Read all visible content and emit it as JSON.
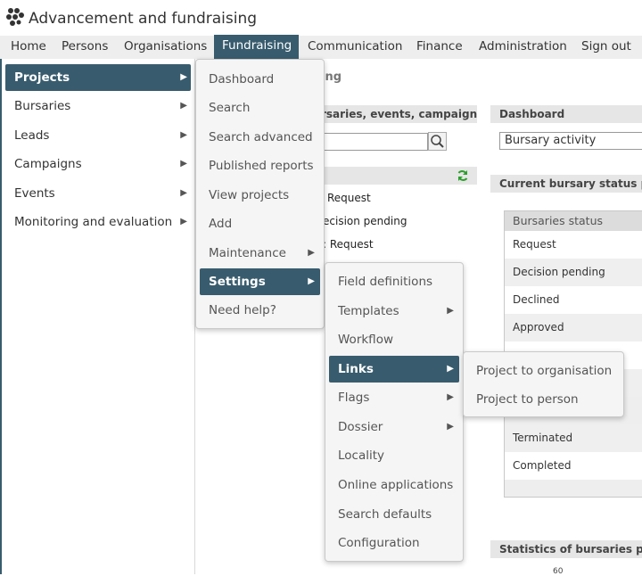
{
  "app": {
    "title": "Advancement and fundraising"
  },
  "menubar": [
    {
      "label": "Home"
    },
    {
      "label": "Persons"
    },
    {
      "label": "Organisations"
    },
    {
      "label": "Fundraising",
      "active": true
    },
    {
      "label": "Communication"
    },
    {
      "label": "Finance"
    },
    {
      "label": "Administration"
    },
    {
      "label": "Sign out"
    }
  ],
  "side_menu": [
    {
      "label": "Projects",
      "active": true
    },
    {
      "label": "Bursaries"
    },
    {
      "label": "Leads"
    },
    {
      "label": "Campaigns"
    },
    {
      "label": "Events"
    },
    {
      "label": "Monitoring and evaluation"
    }
  ],
  "projects_menu": [
    {
      "label": "Dashboard"
    },
    {
      "label": "Search"
    },
    {
      "label": "Search advanced"
    },
    {
      "label": "Published reports"
    },
    {
      "label": "View projects"
    },
    {
      "label": "Add"
    },
    {
      "label": "Maintenance"
    },
    {
      "label": "Settings",
      "active": true
    },
    {
      "label": "Need help?"
    }
  ],
  "settings_menu": [
    {
      "label": "Field definitions"
    },
    {
      "label": "Templates"
    },
    {
      "label": "Workflow"
    },
    {
      "label": "Links",
      "active": true
    },
    {
      "label": "Flags"
    },
    {
      "label": "Dossier"
    },
    {
      "label": "Locality"
    },
    {
      "label": "Online applications"
    },
    {
      "label": "Search defaults"
    },
    {
      "label": "Configuration"
    }
  ],
  "links_menu": [
    {
      "label": "Project to organisation"
    },
    {
      "label": "Project to person"
    }
  ],
  "background": {
    "crumb_fragment": "ing",
    "search_panel_title": "rsaries, events, campaigns",
    "list_items": [
      "Request",
      "ecision pending",
      ": Request"
    ],
    "dashboard_title": "Dashboard",
    "dashboard_select": "Bursary activity",
    "status_panel_title": "Current bursary status pe",
    "status_table_header": "Bursaries status",
    "status_rows": [
      "Request",
      "Decision pending",
      "Declined",
      "Approved",
      "",
      "",
      "Terminated",
      "Completed"
    ],
    "stats_panel_title": "Statistics of bursaries pro",
    "axis_fragment": "60"
  },
  "colors": {
    "accent": "#385c6e",
    "menubar_bg": "#eeeeee",
    "refresh_icon": "#2aa02a"
  }
}
